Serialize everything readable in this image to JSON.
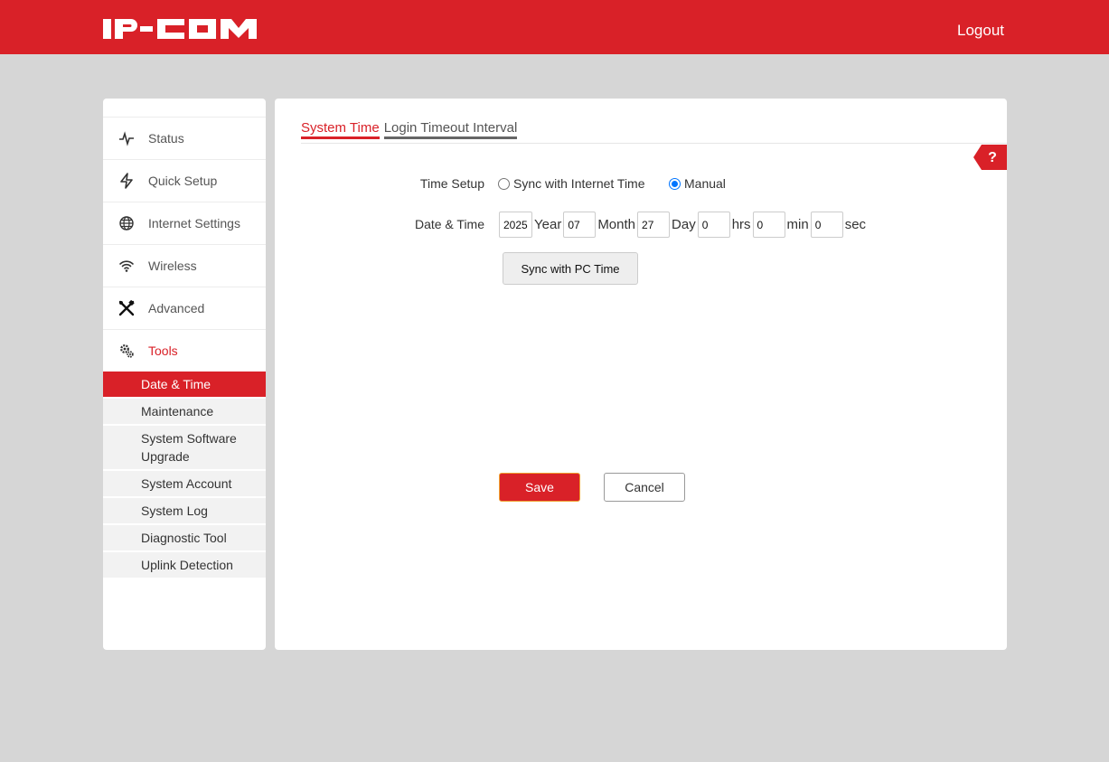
{
  "header": {
    "logo_text": "IP-COM",
    "logout_label": "Logout",
    "brand_color": "#d92128"
  },
  "sidebar": {
    "items": [
      {
        "label": "Status",
        "icon": "activity-icon"
      },
      {
        "label": "Quick Setup",
        "icon": "lightning-icon"
      },
      {
        "label": "Internet Settings",
        "icon": "globe-icon"
      },
      {
        "label": "Wireless",
        "icon": "wifi-icon"
      },
      {
        "label": "Advanced",
        "icon": "tools-icon"
      },
      {
        "label": "Tools",
        "icon": "gears-icon",
        "active": true
      }
    ],
    "submenu": [
      {
        "label": "Date & Time",
        "active": true
      },
      {
        "label": "Maintenance"
      },
      {
        "label": "System Software Upgrade"
      },
      {
        "label": "System Account"
      },
      {
        "label": "System Log"
      },
      {
        "label": "Diagnostic Tool"
      },
      {
        "label": "Uplink Detection"
      }
    ]
  },
  "main": {
    "tabs": [
      {
        "label": "System Time",
        "active": true
      },
      {
        "label": "Login Timeout Interval"
      }
    ],
    "help_label": "?",
    "time_setup": {
      "label": "Time Setup",
      "option_sync": "Sync with Internet Time",
      "option_manual": "Manual",
      "selected": "Manual"
    },
    "date_time": {
      "label": "Date & Time",
      "year": "2025",
      "year_unit": "Year",
      "month": "07",
      "month_unit": "Month",
      "day": "27",
      "day_unit": "Day",
      "hours": "0",
      "hours_unit": "hrs",
      "minutes": "0",
      "minutes_unit": "min",
      "seconds": "0",
      "seconds_unit": "sec"
    },
    "sync_pc_label": "Sync with PC Time",
    "save_label": "Save",
    "cancel_label": "Cancel"
  }
}
